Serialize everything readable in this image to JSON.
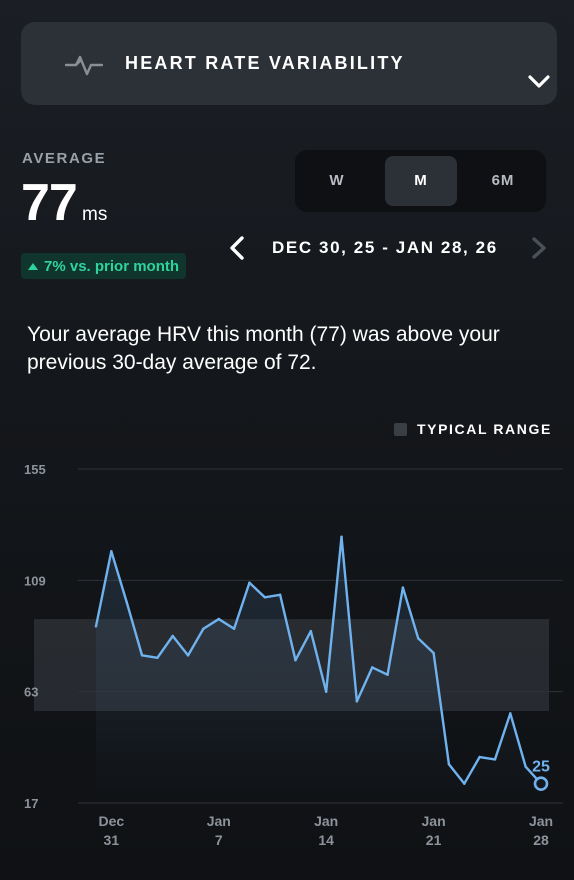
{
  "metric": {
    "title": "HEART RATE VARIABILITY",
    "icon": "pulse-icon",
    "dropdown_icon": "chevron-down-icon"
  },
  "summary_stat": {
    "label": "AVERAGE",
    "value": "77",
    "unit": "ms",
    "delta": "7% vs. prior month",
    "delta_color": "#2fd39c"
  },
  "range": {
    "options": [
      "W",
      "M",
      "6M"
    ],
    "selected": "M"
  },
  "date_nav": {
    "label": "DEC 30, 25 - JAN 28, 26",
    "prev_icon": "chevron-left-icon",
    "next_icon": "chevron-right-icon"
  },
  "insight": "Your average HRV this month (77) was above your previous 30-day average of 72.",
  "legend": {
    "label": "TYPICAL RANGE"
  },
  "chart_data": {
    "type": "line",
    "series": [
      {
        "name": "",
        "color": "#6fb2ee",
        "values": [
          90,
          121,
          100,
          78,
          77,
          86,
          78,
          89,
          93,
          89,
          108,
          102,
          103,
          76,
          88,
          63,
          127,
          59,
          73,
          70,
          106,
          85,
          79,
          33,
          25,
          36,
          35,
          54,
          32,
          25
        ]
      }
    ],
    "y_ticks": [
      "155",
      "109",
      "63",
      "17"
    ],
    "ylim": [
      17,
      155
    ],
    "x_ticks": [
      {
        "month": "Dec",
        "day": "31",
        "index": 1
      },
      {
        "month": "Jan",
        "day": "7",
        "index": 8
      },
      {
        "month": "Jan",
        "day": "14",
        "index": 15
      },
      {
        "month": "Jan",
        "day": "21",
        "index": 22
      },
      {
        "month": "Jan",
        "day": "28",
        "index": 29
      }
    ],
    "typical_range": [
      55,
      93
    ],
    "last_value_label": "25",
    "grid": true,
    "colors": {
      "line": "#6fb2ee",
      "band": "#3a3e45",
      "grid": "#2e3238"
    }
  }
}
